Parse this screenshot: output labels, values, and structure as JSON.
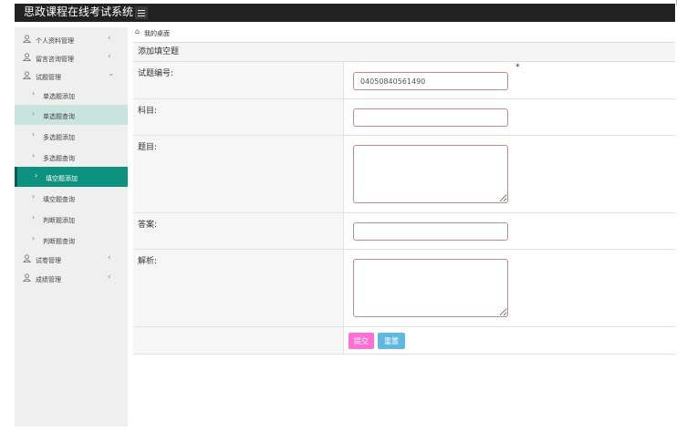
{
  "app": {
    "title": "思政课程在线考试系统"
  },
  "sidebar": {
    "items": [
      {
        "label": "个人资料管理"
      },
      {
        "label": "留言咨询管理"
      },
      {
        "label": "试题管理"
      },
      {
        "label": "单选题添加"
      },
      {
        "label": "单选题查询"
      },
      {
        "label": "多选题添加"
      },
      {
        "label": "多选题查询"
      },
      {
        "label": "填空题添加"
      },
      {
        "label": "填空题查询"
      },
      {
        "label": "判断题添加"
      },
      {
        "label": "判断题查询"
      },
      {
        "label": "试卷管理"
      },
      {
        "label": "成绩管理"
      }
    ],
    "active_item": "填空题添加"
  },
  "breadcrumb": {
    "text": "我的桌面"
  },
  "form": {
    "title": "添加填空题",
    "fields": [
      {
        "label": "试题编号:",
        "value": "04050840561490",
        "required_mark": "*"
      },
      {
        "label": "科目:",
        "value": ""
      },
      {
        "label": "题目:",
        "value": ""
      },
      {
        "label": "答案:",
        "value": ""
      },
      {
        "label": "解析:",
        "value": ""
      }
    ],
    "submit_label": "提交",
    "reset_label": "重置"
  },
  "colors": {
    "topbar": "#222222",
    "active_menu": "#0e9280",
    "hover_menu": "#c9e3df",
    "submit": "#ff6fd6",
    "reset": "#5fb9de",
    "input_border": "#c28a8a"
  },
  "icons": {
    "menu_group": "user-icon",
    "submenu": "chevron-right-icon",
    "expand": "chevron-left-icon",
    "expanded": "chevron-down-icon",
    "breadcrumb": "home-icon",
    "toggle": "hamburger-icon"
  }
}
